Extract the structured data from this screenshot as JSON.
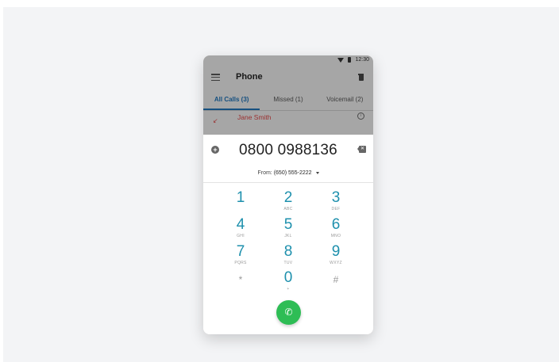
{
  "status": {
    "time": "12:30"
  },
  "app": {
    "title": "Phone",
    "tabs": [
      {
        "label": "All Calls (3)",
        "active": true
      },
      {
        "label": "Missed (1)",
        "active": false
      },
      {
        "label": "Voicemail (2)",
        "active": false
      }
    ],
    "calls": [
      {
        "name": "Jane Smith",
        "missed": true
      }
    ]
  },
  "dialer": {
    "number": "0800 0988136",
    "from_label": "From:",
    "from_value": "(650) 555-2222",
    "keys": [
      {
        "digit": "1",
        "letters": ""
      },
      {
        "digit": "2",
        "letters": "ABC"
      },
      {
        "digit": "3",
        "letters": "DEF"
      },
      {
        "digit": "4",
        "letters": "GHI"
      },
      {
        "digit": "5",
        "letters": "JKL"
      },
      {
        "digit": "6",
        "letters": "MNO"
      },
      {
        "digit": "7",
        "letters": "PQRS"
      },
      {
        "digit": "8",
        "letters": "TUV"
      },
      {
        "digit": "9",
        "letters": "WXYZ"
      },
      {
        "digit": "*",
        "letters": ""
      },
      {
        "digit": "0",
        "letters": "+"
      },
      {
        "digit": "#",
        "letters": ""
      }
    ]
  },
  "icons": {
    "menu": "menu-icon",
    "trash": "trash-icon",
    "add": "add-icon",
    "backspace": "backspace-icon",
    "call": "phone-icon",
    "info": "info-icon"
  },
  "colors": {
    "accent": "#1e90ad",
    "tab_active": "#1f6fb2",
    "call_green": "#2ebd55",
    "missed_red": "#d64545"
  }
}
